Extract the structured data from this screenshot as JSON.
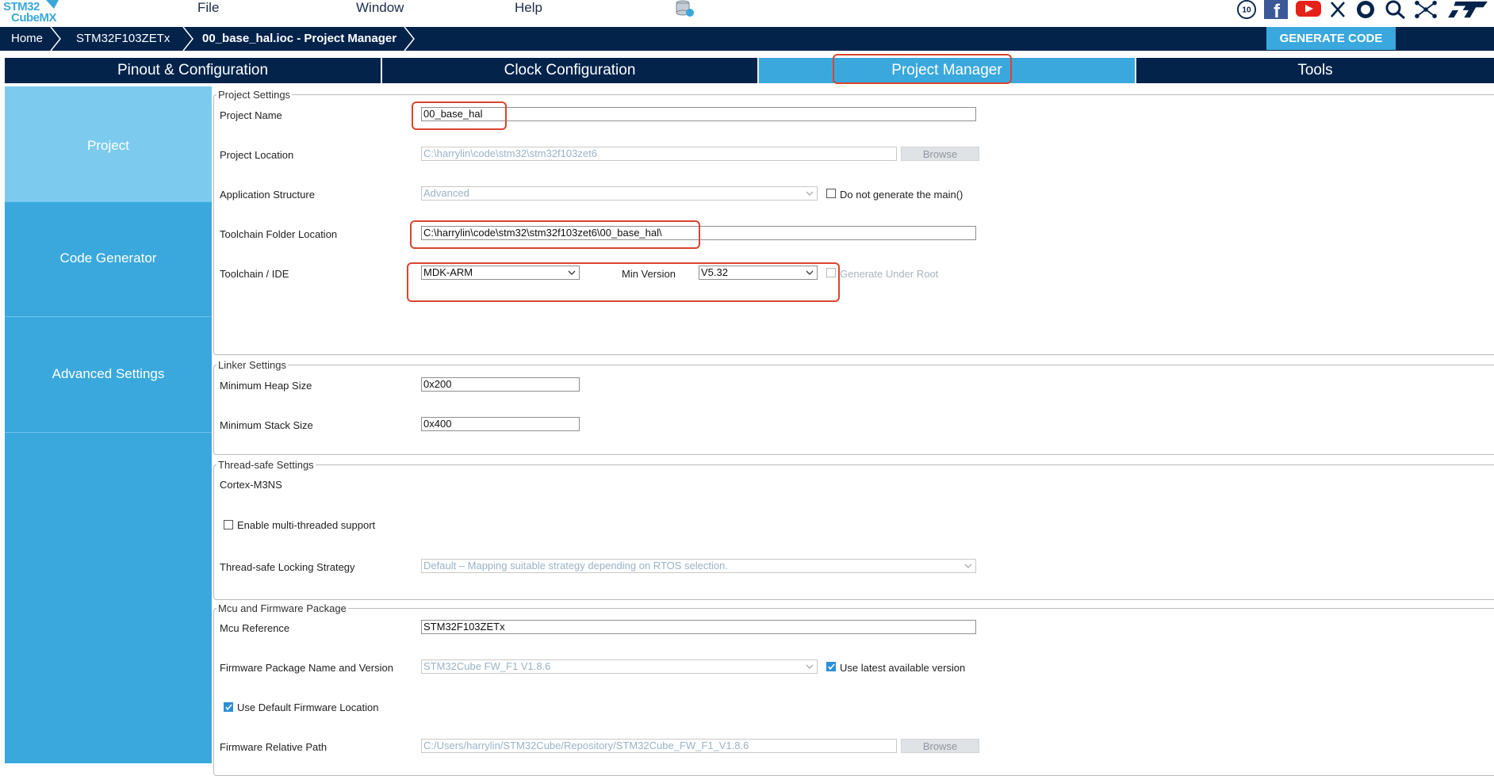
{
  "app": {
    "logo_line1": "STM32",
    "logo_line2": "CubeMX"
  },
  "menu": [
    "File",
    "Window",
    "Help"
  ],
  "social_icons": [
    "anniversary-10-icon",
    "facebook-icon",
    "youtube-icon",
    "x-icon",
    "github-icon",
    "search-community-icon",
    "network-icon",
    "st-logo-icon"
  ],
  "breadcrumb": [
    "Home",
    "STM32F103ZETx",
    "00_base_hal.ioc - Project Manager"
  ],
  "generate_button": "GENERATE CODE",
  "tabs": [
    "Pinout & Configuration",
    "Clock Configuration",
    "Project Manager",
    "Tools"
  ],
  "active_tab": "Project Manager",
  "sidebar": [
    "Project",
    "Code Generator",
    "Advanced Settings"
  ],
  "project_settings": {
    "legend": "Project Settings",
    "project_name_label": "Project Name",
    "project_name_value": "00_base_hal",
    "project_location_label": "Project Location",
    "project_location_value": "C:\\harrylin\\code\\stm32\\stm32f103zet6",
    "browse_label": "Browse",
    "app_structure_label": "Application Structure",
    "app_structure_value": "Advanced",
    "no_main_label": "Do not generate the main()",
    "toolchain_folder_label": "Toolchain Folder Location",
    "toolchain_folder_value": "C:\\harrylin\\code\\stm32\\stm32f103zet6\\00_base_hal\\",
    "toolchain_ide_label": "Toolchain / IDE",
    "toolchain_ide_value": "MDK-ARM",
    "min_version_label": "Min Version",
    "min_version_value": "V5.32",
    "gen_under_root_label": "Generate Under Root"
  },
  "linker_settings": {
    "legend": "Linker Settings",
    "heap_label": "Minimum Heap Size",
    "heap_value": "0x200",
    "stack_label": "Minimum Stack Size",
    "stack_value": "0x400"
  },
  "thread_safe": {
    "legend": "Thread-safe Settings",
    "core": "Cortex-M3NS",
    "multithread_label": "Enable multi-threaded support",
    "strategy_label": "Thread-safe Locking Strategy",
    "strategy_value": "Default – Mapping suitable strategy depending on RTOS selection."
  },
  "mcu_firmware": {
    "legend": "Mcu and Firmware Package",
    "mcu_ref_label": "Mcu Reference",
    "mcu_ref_value": "STM32F103ZETx",
    "fw_pkg_label": "Firmware Package Name and Version",
    "fw_pkg_value": "STM32Cube FW_F1 V1.8.6",
    "use_latest_label": "Use latest available version",
    "use_default_loc_label": "Use Default Firmware Location",
    "fw_rel_path_label": "Firmware Relative Path",
    "fw_rel_path_value": "C:/Users/harrylin/STM32Cube/Repository/STM32Cube_FW_F1_V1.8.6",
    "browse_label": "Browse"
  },
  "colors": {
    "navy": "#03234b",
    "accent": "#3aa8dc",
    "highlight": "#d9452f"
  }
}
